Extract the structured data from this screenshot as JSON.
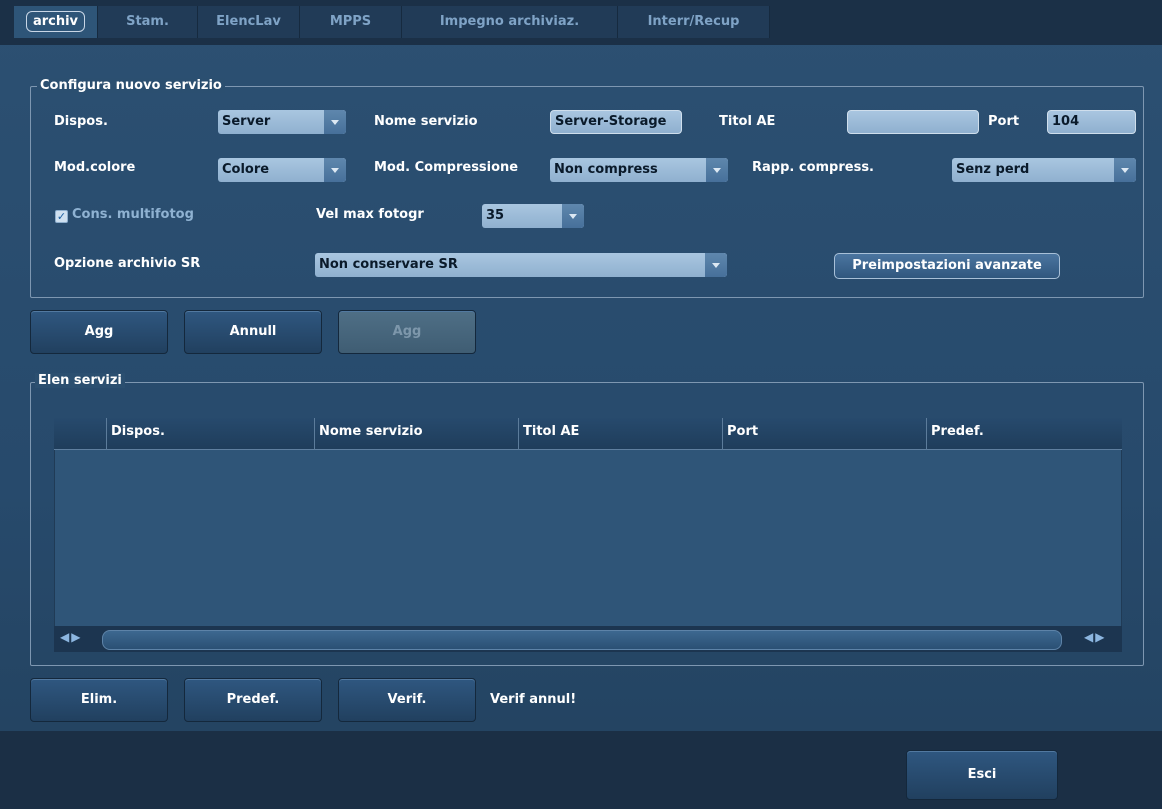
{
  "tabs": [
    {
      "label": "archiv",
      "active": true
    },
    {
      "label": "Stam.",
      "active": false
    },
    {
      "label": "ElencLav",
      "active": false
    },
    {
      "label": "MPPS",
      "active": false
    },
    {
      "label": "Impegno archiviaz.",
      "active": false
    },
    {
      "label": "Interr/Recup",
      "active": false
    }
  ],
  "config": {
    "title": "Configura nuovo servizio",
    "device_label": "Dispos.",
    "device_value": "Server",
    "service_name_label": "Nome servizio",
    "service_name_value": "Server-Storage",
    "ae_title_label": "Titol AE",
    "ae_title_value": "",
    "port_label": "Port",
    "port_value": "104",
    "color_mode_label": "Mod.colore",
    "color_mode_value": "Colore",
    "compression_mode_label": "Mod. Compressione",
    "compression_mode_value": "Non compress",
    "compression_ratio_label": "Rapp. compress.",
    "compression_ratio_value": "Senz perd",
    "multiframe_label": "Cons. multifotog",
    "multiframe_checked": true,
    "max_framerate_label": "Vel max fotogr",
    "max_framerate_value": "35",
    "sr_option_label": "Opzione archivio SR",
    "sr_option_value": "Non conservare SR",
    "advanced_label": "Preimpostazioni avanzate"
  },
  "actions": {
    "add": "Agg",
    "cancel": "Annull",
    "update": "Agg"
  },
  "services": {
    "title": "Elen servizi",
    "columns": [
      "Dispos.",
      "Nome servizio",
      "Titol AE",
      "Port",
      "Predef."
    ],
    "rows": []
  },
  "bottom": {
    "delete": "Elim.",
    "default": "Predef.",
    "verify": "Verif.",
    "status": "Verif annul!",
    "exit": "Esci"
  },
  "colors": {
    "background": "#274a6c",
    "field": "#a9c6e0",
    "tabbar": "#1b3047"
  }
}
